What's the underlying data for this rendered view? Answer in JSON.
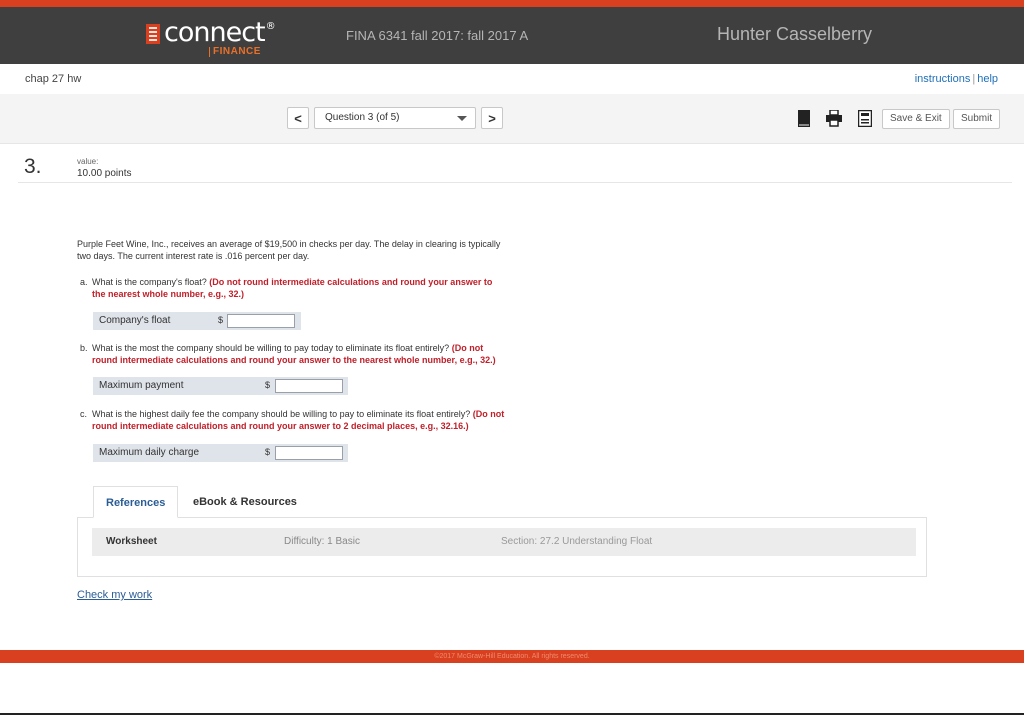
{
  "header": {
    "logo_text": "connect",
    "logo_reg": "®",
    "logo_sub": "FINANCE",
    "course": "FINA 6341 fall 2017: fall 2017 A",
    "user": "Hunter Casselberry"
  },
  "assignment": {
    "name": "chap 27 hw",
    "instructions_link": "instructions",
    "separator": "|",
    "help_link": "help"
  },
  "nav": {
    "prev_label": "<",
    "next_label": ">",
    "question_select": "Question 3 (of 5)",
    "save_exit_label": "Save & Exit",
    "submit_label": "Submit",
    "tool_icons": [
      "book-icon",
      "print-icon",
      "calculator-icon"
    ]
  },
  "question": {
    "number": "3.",
    "value_label": "value:",
    "points": "10.00 points",
    "text_line1": "Purple Feet Wine, Inc., receives an average of $19,500 in checks per day. The delay in clearing is typically",
    "text_line2": "two days. The current interest rate is .016 percent per day.",
    "parts": [
      {
        "letter": "a.",
        "text": "What is the company's float?",
        "instruction_line1": "(Do not round intermediate calculations and round your answer to",
        "instruction_line2": "the nearest whole number, e.g., 32.)",
        "field_label": "Company's float",
        "currency": "$",
        "value": ""
      },
      {
        "letter": "b.",
        "text": "What is the most the company should be willing to pay today to eliminate its float entirely?",
        "instruction_line1": "(Do not",
        "instruction_line2": "round intermediate calculations and round your answer to the nearest whole number, e.g., 32.)",
        "field_label": "Maximum payment",
        "currency": "$",
        "value": ""
      },
      {
        "letter": "c.",
        "text": "What is the highest daily fee the company should be willing to pay to eliminate its float entirely?",
        "instruction_line1": "(Do not",
        "instruction_line2": "round intermediate calculations and round your answer to 2 decimal places, e.g., 32.16.)",
        "field_label": "Maximum daily charge",
        "currency": "$",
        "value": ""
      }
    ]
  },
  "tabs": {
    "references": "References",
    "ebook": "eBook & Resources",
    "worksheet": "Worksheet",
    "difficulty": "Difficulty: 1 Basic",
    "section": "Section: 27.2 Understanding Float"
  },
  "check_work": "Check my work",
  "footer": "©2017 McGraw-Hill Education. All rights reserved.",
  "colors": {
    "brand_red": "#d9401f",
    "topbar": "#3f3f3f",
    "link_blue": "#2a5c96",
    "instruction_red": "#c0202a"
  }
}
